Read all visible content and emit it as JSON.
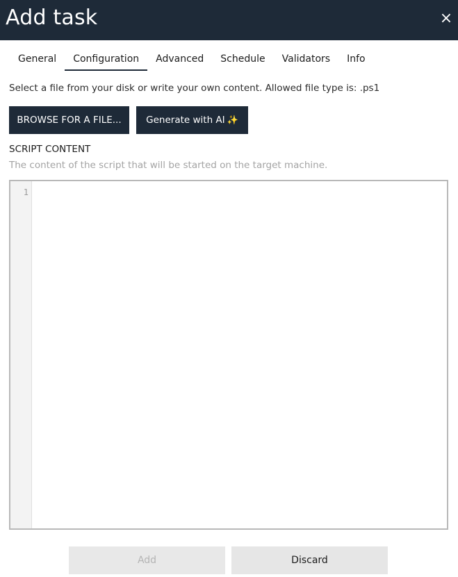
{
  "dialog": {
    "title": "Add task",
    "close_glyph": "×"
  },
  "tabs": [
    {
      "label": "General",
      "active": false
    },
    {
      "label": "Configuration",
      "active": true
    },
    {
      "label": "Advanced",
      "active": false
    },
    {
      "label": "Schedule",
      "active": false
    },
    {
      "label": "Validators",
      "active": false
    },
    {
      "label": "Info",
      "active": false
    }
  ],
  "file": {
    "helper_text": "Select a file from your disk or write your own content. Allowed file type is: .ps1",
    "browse_label": "BROWSE FOR A FILE...",
    "ai_label": "Generate with AI",
    "ai_icon": "sparkle-icon",
    "ai_icon_glyph": "✨"
  },
  "script": {
    "section_title": "SCRIPT CONTENT",
    "description": "The content of the script that will be started on the target machine.",
    "line_numbers": [
      "1"
    ],
    "content": ""
  },
  "footer": {
    "add_label": "Add",
    "add_disabled": true,
    "discard_label": "Discard"
  },
  "colors": {
    "header_bg": "#1e2a38",
    "button_dark": "#1e2a38",
    "muted_text": "#a3a3a3"
  }
}
